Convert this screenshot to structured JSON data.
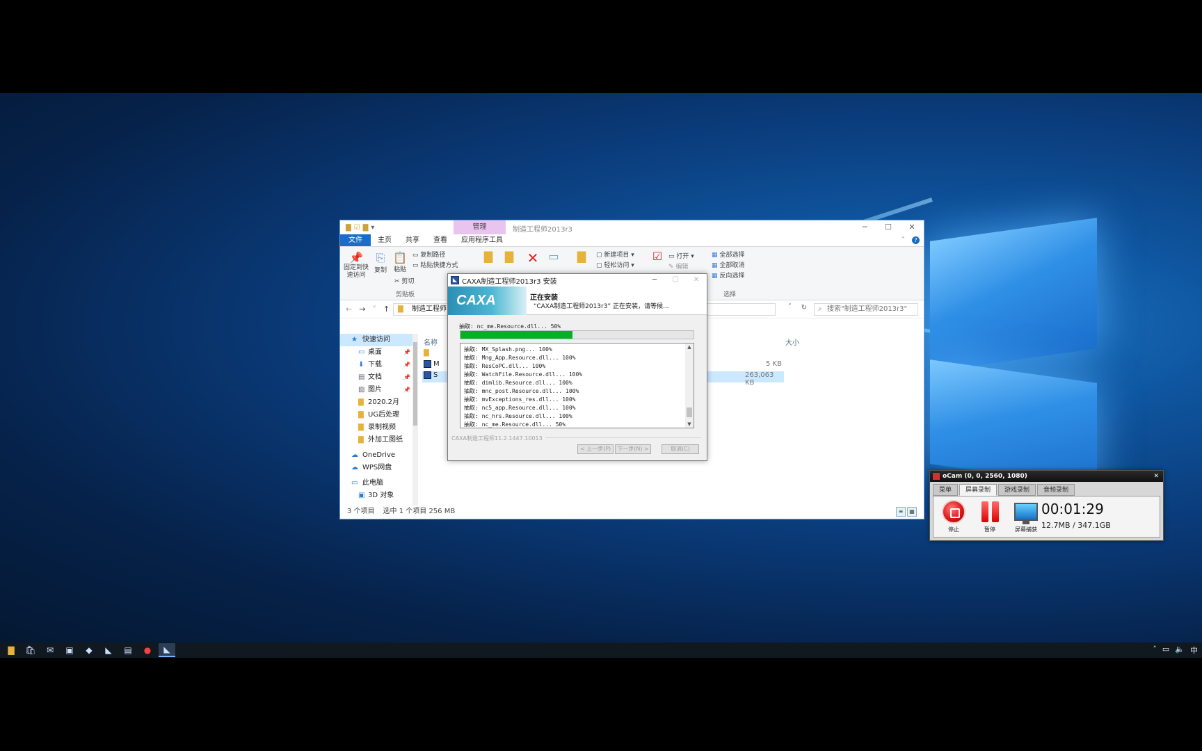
{
  "explorer": {
    "manage_tab": "管理",
    "title": "制造工程师2013r3",
    "tabs": [
      "文件",
      "主页",
      "共享",
      "查看",
      "应用程序工具"
    ],
    "ribbon": {
      "pin_quick_access": "固定到快速访问",
      "copy": "复制",
      "paste": "粘贴",
      "copy_path": "复制路径",
      "paste_shortcut": "粘贴快捷方式",
      "cut": "剪切",
      "clipboard_group": "剪贴板",
      "new_item": "新建项目",
      "easy_access": "轻松访问",
      "open": "打开",
      "edit": "编辑",
      "select_all": "全部选择",
      "select_none": "全部取消",
      "invert_selection": "反向选择",
      "select_group": "选择"
    },
    "address_path": "制造工程师",
    "search_placeholder": "搜索\"制造工程师2013r3\"",
    "nav": [
      {
        "label": "快速访问",
        "icon": "star-icon",
        "pin": false
      },
      {
        "label": "桌面",
        "icon": "desktop-icon",
        "pin": true
      },
      {
        "label": "下载",
        "icon": "download-icon",
        "pin": true
      },
      {
        "label": "文档",
        "icon": "document-icon",
        "pin": true
      },
      {
        "label": "图片",
        "icon": "picture-icon",
        "pin": true
      },
      {
        "label": "2020.2月",
        "icon": "folder-icon",
        "pin": false
      },
      {
        "label": "UG后处理",
        "icon": "folder-icon",
        "pin": false
      },
      {
        "label": "录制视频",
        "icon": "folder-icon",
        "pin": false
      },
      {
        "label": "外加工图纸",
        "icon": "folder-icon",
        "pin": false
      },
      {
        "label": "OneDrive",
        "icon": "cloud-icon",
        "pin": false
      },
      {
        "label": "WPS网盘",
        "icon": "cloud-icon",
        "pin": false
      },
      {
        "label": "此电脑",
        "icon": "computer-icon",
        "pin": false
      },
      {
        "label": "3D 对象",
        "icon": "cube-icon",
        "pin": false
      }
    ],
    "col_name": "名称",
    "col_size": "大小",
    "file_rows": [
      {
        "name": "…",
        "size": ""
      },
      {
        "name": "M",
        "size": "5 KB"
      },
      {
        "name": "S",
        "size": "263,063 KB"
      }
    ],
    "status_count": "3 个项目",
    "status_selected": "选中 1 个项目  256 MB"
  },
  "installer": {
    "title": "CAXA制造工程师2013r3 安装",
    "logo_text": "CAXA",
    "heading": "正在安装",
    "subheading": "“CAXA制造工程师2013r3” 正在安装，请等候...",
    "current_extract": "抽取: nc_me.Resource.dll... 50%",
    "progress_percent": 48,
    "log_lines": [
      "抽取: MX_Splash.png... 100%",
      "抽取: Mng_App.Resource.dll... 100%",
      "抽取: ResCoPC.dll... 100%",
      "抽取: WatchFile.Resource.dll... 100%",
      "抽取: dimlib.Resource.dll... 100%",
      "抽取: mnc_post.Resource.dll... 100%",
      "抽取: mvExceptions_res.dll... 100%",
      "抽取: nc5_app.Resource.dll... 100%",
      "抽取: nc_hrs.Resource.dll... 100%",
      "抽取: nc_me.Resource.dll... 50%"
    ],
    "branding": "CAXA制造工程师11.2.1447.10013",
    "btn_back": "< 上一步(P)",
    "btn_next": "下一步(N) >",
    "btn_cancel": "取消(C)"
  },
  "ocam": {
    "title": "oCam (0, 0, 2560, 1080)",
    "tabs": [
      "菜单",
      "屏幕录制",
      "游戏录制",
      "音频录制"
    ],
    "active_tab": 1,
    "stop_label": "停止",
    "pause_label": "暂停",
    "screen_label": "屏幕捕获",
    "time": "00:01:29",
    "size": "12.7MB / 347.1GB"
  },
  "taskbar": {
    "tray_ime": "中"
  }
}
